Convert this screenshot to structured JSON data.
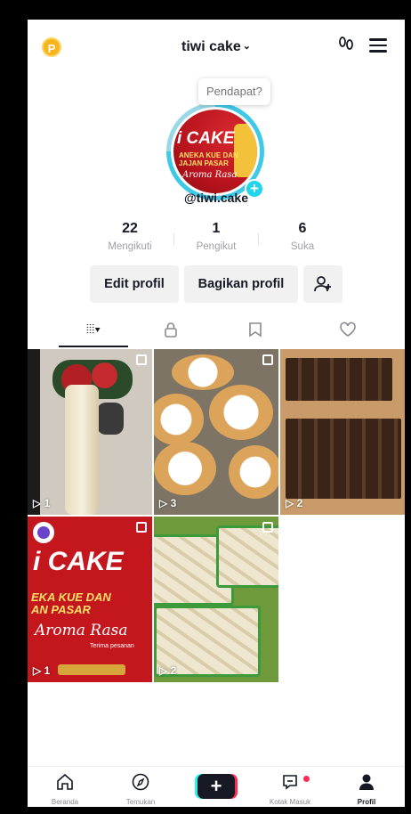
{
  "header": {
    "coin_label": "P",
    "username": "tiwi cake",
    "chevron": "⌄",
    "footprint_icon": "footprint-icon",
    "menu_icon": "hamburger-menu-icon"
  },
  "profile": {
    "tooltip": "Pendapat?",
    "handle": "@tiwi.cake",
    "avatar_title": "i CAKE",
    "avatar_sub": "ANEKA KUE DAN\nJAJAN PASAR",
    "avatar_script": "Aroma Rasa",
    "avatar_plus": "+"
  },
  "stats": [
    {
      "value": "22",
      "label": "Mengikuti"
    },
    {
      "value": "1",
      "label": "Pengikut"
    },
    {
      "value": "6",
      "label": "Suka"
    }
  ],
  "actions": {
    "edit": "Edit profil",
    "share": "Bagikan profil",
    "add_friend_icon": "add-friend-icon"
  },
  "tabs": [
    {
      "icon": "grid-icon",
      "glyph": "⦙⦙⦙▾",
      "active": true
    },
    {
      "icon": "lock-icon",
      "glyph": "🔒︎",
      "active": false
    },
    {
      "icon": "repost-icon",
      "glyph": "⟲",
      "active": false
    },
    {
      "icon": "liked-icon",
      "glyph": "♡",
      "active": false
    }
  ],
  "videos": [
    {
      "plays": "▷ 1"
    },
    {
      "plays": "▷ 3"
    },
    {
      "plays": "▷ 2"
    },
    {
      "plays": "▷ 1"
    },
    {
      "plays": "▷ 2"
    }
  ],
  "video4": {
    "title": "i CAKE",
    "sub": "EKA KUE DAN\nAN PASAR",
    "script": "Aroma Rasa",
    "small": "Terima pesanan"
  },
  "nav": [
    {
      "label": "Beranda",
      "icon": "home-icon",
      "glyph": "⌂"
    },
    {
      "label": "Temukan",
      "icon": "compass-icon",
      "glyph": "◎"
    },
    {
      "label": "+",
      "icon": "create-icon"
    },
    {
      "label": "Kotak Masuk",
      "icon": "inbox-icon",
      "glyph": "▭"
    },
    {
      "label": "Profil",
      "icon": "profile-icon",
      "glyph": "●"
    }
  ],
  "colors": {
    "accent": "#20d5ec",
    "brand_red": "#fe2c55",
    "coin": "#f6b51e"
  }
}
